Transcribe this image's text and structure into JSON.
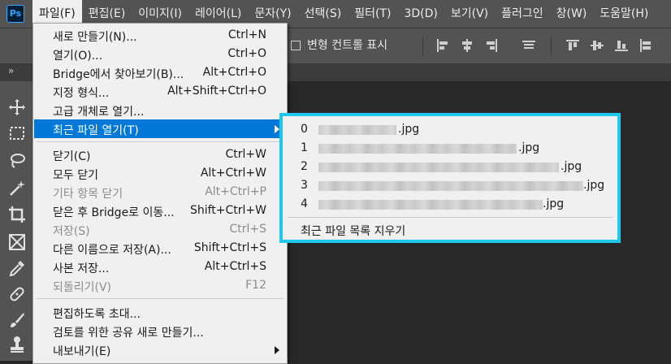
{
  "app": {
    "logo": "Ps"
  },
  "menubar": [
    {
      "label": "파일(F)",
      "active": true
    },
    {
      "label": "편집(E)"
    },
    {
      "label": "이미지(I)"
    },
    {
      "label": "레이어(L)"
    },
    {
      "label": "문자(Y)"
    },
    {
      "label": "선택(S)"
    },
    {
      "label": "필터(T)"
    },
    {
      "label": "3D(D)"
    },
    {
      "label": "보기(V)"
    },
    {
      "label": "플러그인"
    },
    {
      "label": "창(W)"
    },
    {
      "label": "도움말(H)"
    }
  ],
  "options_bar": {
    "transform_controls_label": "변형 컨트롤 표시"
  },
  "tabbar": {
    "collapse_icon": "»"
  },
  "file_menu": {
    "items": [
      {
        "label": "새로 만들기(N)...",
        "shortcut": "Ctrl+N"
      },
      {
        "label": "열기(O)...",
        "shortcut": "Ctrl+O"
      },
      {
        "label": "Bridge에서 찾아보기(B)...",
        "shortcut": "Alt+Ctrl+O"
      },
      {
        "label": "지정 형식...",
        "shortcut": "Alt+Shift+Ctrl+O"
      },
      {
        "label": "고급 개체로 열기...",
        "shortcut": ""
      },
      {
        "label": "최근 파일 열기(T)",
        "shortcut": "",
        "highlighted": true,
        "submenu": true
      },
      {
        "label": "닫기(C)",
        "shortcut": "Ctrl+W"
      },
      {
        "label": "모두 닫기",
        "shortcut": "Alt+Ctrl+W"
      },
      {
        "label": "기타 항목 닫기",
        "shortcut": "Alt+Ctrl+P",
        "disabled": true
      },
      {
        "label": "닫은 후 Bridge로 이동...",
        "shortcut": "Shift+Ctrl+W"
      },
      {
        "label": "저장(S)",
        "shortcut": "Ctrl+S",
        "disabled": true
      },
      {
        "label": "다른 이름으로 저장(A)...",
        "shortcut": "Shift+Ctrl+S"
      },
      {
        "label": "사본 저장...",
        "shortcut": "Alt+Ctrl+S"
      },
      {
        "label": "되돌리기(V)",
        "shortcut": "F12",
        "disabled": true
      },
      {
        "label": "편집하도록 초대...",
        "shortcut": ""
      },
      {
        "label": "검토를 위한 공유 새로 만들기...",
        "shortcut": ""
      },
      {
        "label": "내보내기(E)",
        "shortcut": "",
        "submenu": true
      }
    ]
  },
  "recent_files": {
    "files": [
      {
        "index": "0",
        "ext": ".jpg"
      },
      {
        "index": "1",
        "ext": ".jpg"
      },
      {
        "index": "2",
        "ext": ".jpg"
      },
      {
        "index": "3",
        "ext": ".jpg"
      },
      {
        "index": "4",
        "ext": ".jpg"
      }
    ],
    "clear_label": "최근 파일 목록 지우기"
  },
  "colors": {
    "menubar": "#535353",
    "highlight": "#0078d7",
    "outline": "#1ec8f0",
    "canvas": "#282828"
  }
}
